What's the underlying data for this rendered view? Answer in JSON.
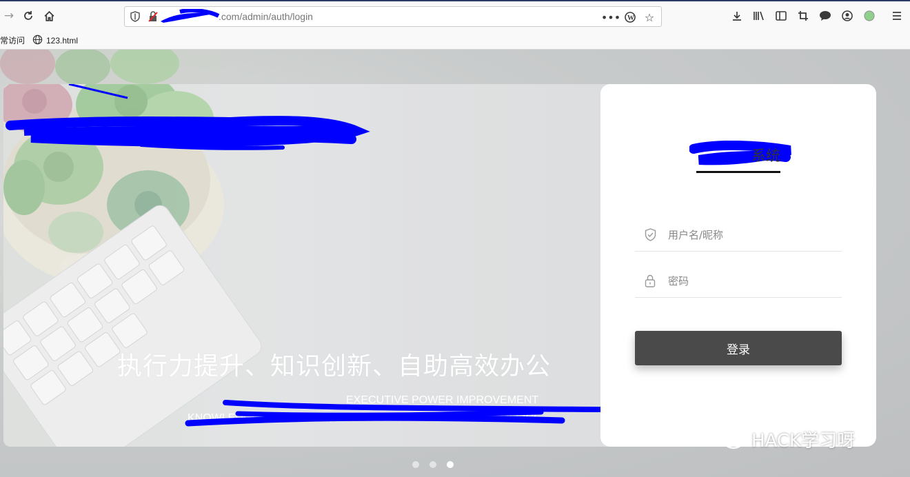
{
  "browser": {
    "url": ".com/admin/auth/login",
    "bookmarks": [
      {
        "label": "常访问",
        "icon": "folder-icon"
      },
      {
        "label": "123.html",
        "icon": "globe-icon"
      }
    ]
  },
  "banner": {
    "slogan_cn": "执行力提升、知识创新、自助高效办公",
    "slogan_en_line1": "EXECUTIVE POWER IMPROVEMENT",
    "slogan_en_line2": "KNOWLEDGE INNOVATION,SELF-SERVICE AND EFFICIENT OFFICE"
  },
  "login": {
    "system_title": "系统",
    "username_placeholder": "用户名/昵称",
    "password_placeholder": "密码",
    "submit_label": "登录"
  },
  "carousel": {
    "count": 3,
    "active": 3
  },
  "watermark": {
    "text": "HACK学习呀"
  },
  "colors": {
    "redaction": "#0000ff",
    "button_bg": "#4a4a4a",
    "card_bg": "#ffffff",
    "chrome_bg": "#f9f9fa"
  }
}
